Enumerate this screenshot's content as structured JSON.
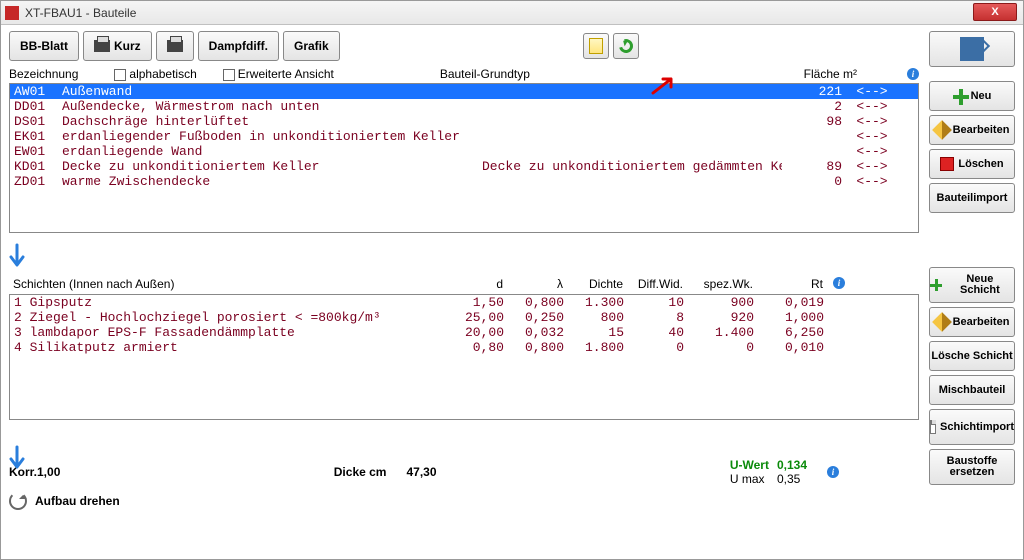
{
  "window": {
    "title": "XT-FBAU1 - Bauteile",
    "close": "X"
  },
  "toolbar": {
    "bb": "BB-Blatt",
    "kurz": "Kurz",
    "dampf": "Dampfdiff.",
    "grafik": "Grafik"
  },
  "filters": {
    "bezeichnung": "Bezeichnung",
    "alpha": "alphabetisch",
    "erw": "Erweiterte Ansicht",
    "grundtyp": "Bauteil-Grundtyp",
    "flaeche": "Fläche  m²"
  },
  "list": [
    {
      "code": "AW01",
      "desc": "Außenwand",
      "typ": "",
      "area": "221",
      "arrow": "<-->",
      "selected": true
    },
    {
      "code": "DD01",
      "desc": "Außendecke, Wärmestrom nach unten",
      "typ": "",
      "area": "2",
      "arrow": "<-->"
    },
    {
      "code": "DS01",
      "desc": "Dachschräge hinterlüftet",
      "typ": "",
      "area": "98",
      "arrow": "<-->"
    },
    {
      "code": "EK01",
      "desc": "erdanliegender Fußboden in unkonditioniertem Keller",
      "typ": "",
      "area": "",
      "arrow": "<-->"
    },
    {
      "code": "EW01",
      "desc": "erdanliegende Wand",
      "typ": "",
      "area": "",
      "arrow": "<-->"
    },
    {
      "code": "KD01",
      "desc": "Decke zu unkonditioniertem Keller",
      "typ": "Decke zu unkonditioniertem gedämmten Kel",
      "area": "89",
      "arrow": "<-->"
    },
    {
      "code": "ZD01",
      "desc": "warme Zwischendecke",
      "typ": "",
      "area": "0",
      "arrow": "<-->"
    }
  ],
  "layers_header": {
    "title": "Schichten (Innen nach Außen)",
    "d": "d",
    "lambda": "λ",
    "dichte": "Dichte",
    "diffwid": "Diff.Wid.",
    "spezwk": "spez.Wk.",
    "rt": "Rt"
  },
  "layers": [
    {
      "n": "1",
      "name": "Gipsputz",
      "d": "1,50",
      "l": "0,800",
      "den": "1.300",
      "dw": "10",
      "sw": "900",
      "rt": "0,019"
    },
    {
      "n": "2",
      "name": "Ziegel - Hochlochziegel porosiert < =800kg/m³",
      "d": "25,00",
      "l": "0,250",
      "den": "800",
      "dw": "8",
      "sw": "920",
      "rt": "1,000"
    },
    {
      "n": "3",
      "name": "lambdapor EPS-F Fassadendämmplatte",
      "d": "20,00",
      "l": "0,032",
      "den": "15",
      "dw": "40",
      "sw": "1.400",
      "rt": "6,250"
    },
    {
      "n": "4",
      "name": "Silikatputz armiert",
      "d": "0,80",
      "l": "0,800",
      "den": "1.800",
      "dw": "0",
      "sw": "0",
      "rt": "0,010"
    }
  ],
  "summary": {
    "korr": "Korr.1,00",
    "dicke_label": "Dicke cm",
    "dicke_value": "47,30",
    "uwert_label": "U-Wert",
    "uwert_value": "0,134",
    "umax_label": "U max",
    "umax_value": "0,35",
    "rotate": "Aufbau drehen"
  },
  "sidebar": {
    "neu": "Neu",
    "bearbeiten": "Bearbeiten",
    "loeschen": "Löschen",
    "bauteilimport": "Bauteilimport",
    "neue_schicht": "Neue Schicht",
    "bearbeiten2": "Bearbeiten",
    "loesche_schicht": "Lösche Schicht",
    "mischbauteil": "Mischbauteil",
    "schichtimport": "Schichtimport",
    "baustoffe": "Baustoffe ersetzen"
  }
}
